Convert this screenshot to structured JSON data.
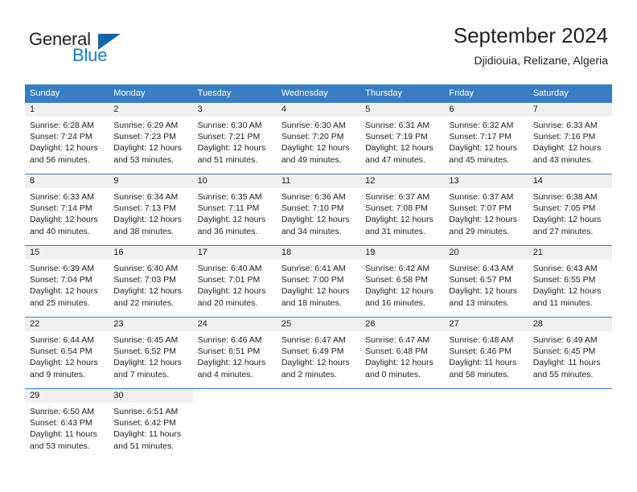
{
  "brand": {
    "name_part1": "General",
    "name_part2": "Blue",
    "mark": "triangle-logo"
  },
  "header": {
    "title": "September 2024",
    "subtitle": "Djidiouia, Relizane, Algeria"
  },
  "colors": {
    "header_blue": "#3a7ec1",
    "brand_blue": "#1a7cc4",
    "daynum_band": "#f0f0f0",
    "text": "#222222"
  },
  "weekday_headers": [
    "Sunday",
    "Monday",
    "Tuesday",
    "Wednesday",
    "Thursday",
    "Friday",
    "Saturday"
  ],
  "weeks": [
    [
      {
        "day": "1",
        "sunrise": "Sunrise: 6:28 AM",
        "sunset": "Sunset: 7:24 PM",
        "daylight1": "Daylight: 12 hours",
        "daylight2": "and 56 minutes."
      },
      {
        "day": "2",
        "sunrise": "Sunrise: 6:29 AM",
        "sunset": "Sunset: 7:23 PM",
        "daylight1": "Daylight: 12 hours",
        "daylight2": "and 53 minutes."
      },
      {
        "day": "3",
        "sunrise": "Sunrise: 6:30 AM",
        "sunset": "Sunset: 7:21 PM",
        "daylight1": "Daylight: 12 hours",
        "daylight2": "and 51 minutes."
      },
      {
        "day": "4",
        "sunrise": "Sunrise: 6:30 AM",
        "sunset": "Sunset: 7:20 PM",
        "daylight1": "Daylight: 12 hours",
        "daylight2": "and 49 minutes."
      },
      {
        "day": "5",
        "sunrise": "Sunrise: 6:31 AM",
        "sunset": "Sunset: 7:19 PM",
        "daylight1": "Daylight: 12 hours",
        "daylight2": "and 47 minutes."
      },
      {
        "day": "6",
        "sunrise": "Sunrise: 6:32 AM",
        "sunset": "Sunset: 7:17 PM",
        "daylight1": "Daylight: 12 hours",
        "daylight2": "and 45 minutes."
      },
      {
        "day": "7",
        "sunrise": "Sunrise: 6:33 AM",
        "sunset": "Sunset: 7:16 PM",
        "daylight1": "Daylight: 12 hours",
        "daylight2": "and 43 minutes."
      }
    ],
    [
      {
        "day": "8",
        "sunrise": "Sunrise: 6:33 AM",
        "sunset": "Sunset: 7:14 PM",
        "daylight1": "Daylight: 12 hours",
        "daylight2": "and 40 minutes."
      },
      {
        "day": "9",
        "sunrise": "Sunrise: 6:34 AM",
        "sunset": "Sunset: 7:13 PM",
        "daylight1": "Daylight: 12 hours",
        "daylight2": "and 38 minutes."
      },
      {
        "day": "10",
        "sunrise": "Sunrise: 6:35 AM",
        "sunset": "Sunset: 7:11 PM",
        "daylight1": "Daylight: 12 hours",
        "daylight2": "and 36 minutes."
      },
      {
        "day": "11",
        "sunrise": "Sunrise: 6:36 AM",
        "sunset": "Sunset: 7:10 PM",
        "daylight1": "Daylight: 12 hours",
        "daylight2": "and 34 minutes."
      },
      {
        "day": "12",
        "sunrise": "Sunrise: 6:37 AM",
        "sunset": "Sunset: 7:08 PM",
        "daylight1": "Daylight: 12 hours",
        "daylight2": "and 31 minutes."
      },
      {
        "day": "13",
        "sunrise": "Sunrise: 6:37 AM",
        "sunset": "Sunset: 7:07 PM",
        "daylight1": "Daylight: 12 hours",
        "daylight2": "and 29 minutes."
      },
      {
        "day": "14",
        "sunrise": "Sunrise: 6:38 AM",
        "sunset": "Sunset: 7:05 PM",
        "daylight1": "Daylight: 12 hours",
        "daylight2": "and 27 minutes."
      }
    ],
    [
      {
        "day": "15",
        "sunrise": "Sunrise: 6:39 AM",
        "sunset": "Sunset: 7:04 PM",
        "daylight1": "Daylight: 12 hours",
        "daylight2": "and 25 minutes."
      },
      {
        "day": "16",
        "sunrise": "Sunrise: 6:40 AM",
        "sunset": "Sunset: 7:03 PM",
        "daylight1": "Daylight: 12 hours",
        "daylight2": "and 22 minutes."
      },
      {
        "day": "17",
        "sunrise": "Sunrise: 6:40 AM",
        "sunset": "Sunset: 7:01 PM",
        "daylight1": "Daylight: 12 hours",
        "daylight2": "and 20 minutes."
      },
      {
        "day": "18",
        "sunrise": "Sunrise: 6:41 AM",
        "sunset": "Sunset: 7:00 PM",
        "daylight1": "Daylight: 12 hours",
        "daylight2": "and 18 minutes."
      },
      {
        "day": "19",
        "sunrise": "Sunrise: 6:42 AM",
        "sunset": "Sunset: 6:58 PM",
        "daylight1": "Daylight: 12 hours",
        "daylight2": "and 16 minutes."
      },
      {
        "day": "20",
        "sunrise": "Sunrise: 6:43 AM",
        "sunset": "Sunset: 6:57 PM",
        "daylight1": "Daylight: 12 hours",
        "daylight2": "and 13 minutes."
      },
      {
        "day": "21",
        "sunrise": "Sunrise: 6:43 AM",
        "sunset": "Sunset: 6:55 PM",
        "daylight1": "Daylight: 12 hours",
        "daylight2": "and 11 minutes."
      }
    ],
    [
      {
        "day": "22",
        "sunrise": "Sunrise: 6:44 AM",
        "sunset": "Sunset: 6:54 PM",
        "daylight1": "Daylight: 12 hours",
        "daylight2": "and 9 minutes."
      },
      {
        "day": "23",
        "sunrise": "Sunrise: 6:45 AM",
        "sunset": "Sunset: 6:52 PM",
        "daylight1": "Daylight: 12 hours",
        "daylight2": "and 7 minutes."
      },
      {
        "day": "24",
        "sunrise": "Sunrise: 6:46 AM",
        "sunset": "Sunset: 6:51 PM",
        "daylight1": "Daylight: 12 hours",
        "daylight2": "and 4 minutes."
      },
      {
        "day": "25",
        "sunrise": "Sunrise: 6:47 AM",
        "sunset": "Sunset: 6:49 PM",
        "daylight1": "Daylight: 12 hours",
        "daylight2": "and 2 minutes."
      },
      {
        "day": "26",
        "sunrise": "Sunrise: 6:47 AM",
        "sunset": "Sunset: 6:48 PM",
        "daylight1": "Daylight: 12 hours",
        "daylight2": "and 0 minutes."
      },
      {
        "day": "27",
        "sunrise": "Sunrise: 6:48 AM",
        "sunset": "Sunset: 6:46 PM",
        "daylight1": "Daylight: 11 hours",
        "daylight2": "and 58 minutes."
      },
      {
        "day": "28",
        "sunrise": "Sunrise: 6:49 AM",
        "sunset": "Sunset: 6:45 PM",
        "daylight1": "Daylight: 11 hours",
        "daylight2": "and 55 minutes."
      }
    ],
    [
      {
        "day": "29",
        "sunrise": "Sunrise: 6:50 AM",
        "sunset": "Sunset: 6:43 PM",
        "daylight1": "Daylight: 11 hours",
        "daylight2": "and 53 minutes."
      },
      {
        "day": "30",
        "sunrise": "Sunrise: 6:51 AM",
        "sunset": "Sunset: 6:42 PM",
        "daylight1": "Daylight: 11 hours",
        "daylight2": "and 51 minutes."
      },
      {
        "day": "",
        "sunrise": "",
        "sunset": "",
        "daylight1": "",
        "daylight2": ""
      },
      {
        "day": "",
        "sunrise": "",
        "sunset": "",
        "daylight1": "",
        "daylight2": ""
      },
      {
        "day": "",
        "sunrise": "",
        "sunset": "",
        "daylight1": "",
        "daylight2": ""
      },
      {
        "day": "",
        "sunrise": "",
        "sunset": "",
        "daylight1": "",
        "daylight2": ""
      },
      {
        "day": "",
        "sunrise": "",
        "sunset": "",
        "daylight1": "",
        "daylight2": ""
      }
    ]
  ]
}
